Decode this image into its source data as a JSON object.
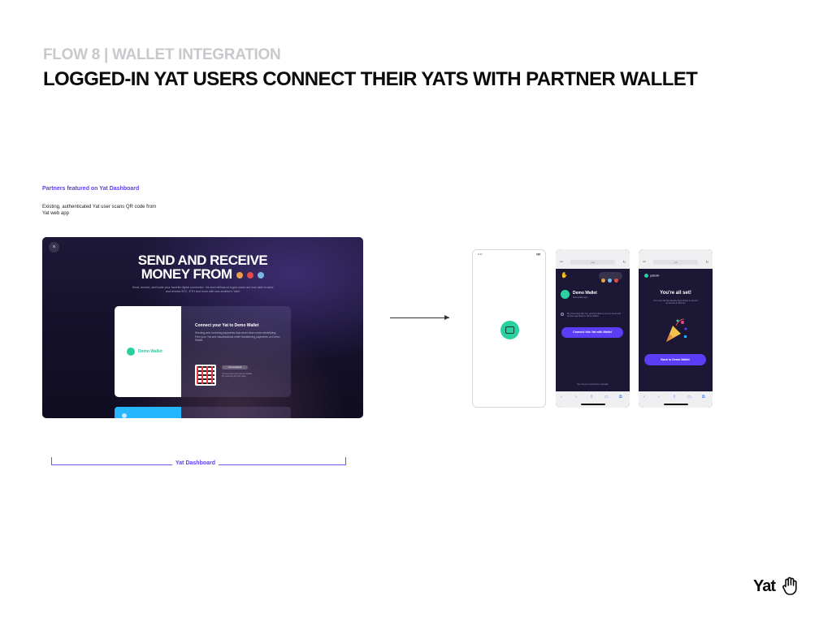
{
  "header": {
    "flow_label": "FLOW 8 | WALLET INTEGRATION",
    "title": "LOGGED-IN YAT USERS CONNECT THEIR YATS WITH PARTNER WALLET"
  },
  "annotation": {
    "partners_title": "Partners featured on Yat Dashboard",
    "description": "Existing, authenticated Yat user scans QR code from Yat web app"
  },
  "dashboard": {
    "close": "×",
    "headline_line1": "SEND AND RECEIVE",
    "headline_line2": "MONEY FROM",
    "subtext": "Send, receive, and trade your favorite digital currencies. Yat and millions of crypto users are now able to send and receive BTC, ETH and more with one another's Yats!",
    "card": {
      "partner_name": "Demo Wallet",
      "title": "Connect your Yat to Demo Wallet",
      "description": "Sending and receiving payments has never been more electrifying. Flex your Yat and visualizations while transferring payments on Demo Wallet.",
      "pill": "Yat connected",
      "qr_caption": "Connect this Yat to Demo Wallet. By scanning the QR code."
    },
    "bracket_label": "Yat Dashboard"
  },
  "phones": {
    "splash": {
      "time": "9:41",
      "signal": "▮▮▮"
    },
    "connect": {
      "aa": "AA",
      "url": "y.at",
      "wallet_name": "Demo Wallet",
      "wallet_sub": "demowallet.app",
      "checkbox_text": "By connecting this Yat, you'll be able to use it to send and receive payments in Demo Wallet.",
      "button": "Connect this Yat with Wallet",
      "footer": "Set Yat your connection manually"
    },
    "success": {
      "aa": "AA",
      "url": "y.at",
      "badge": "yatcoin",
      "title": "You're all set!",
      "description": "Your new Yat has already been linked to all your currencies in DKCoin",
      "button": "Back to Demo Wallet"
    }
  },
  "brand": {
    "logo_text": "Yat"
  },
  "colors": {
    "accent": "#5b3df5",
    "dark_bg": "#1c1735",
    "teal": "#2ad1a0",
    "blue": "#25b6ff"
  }
}
